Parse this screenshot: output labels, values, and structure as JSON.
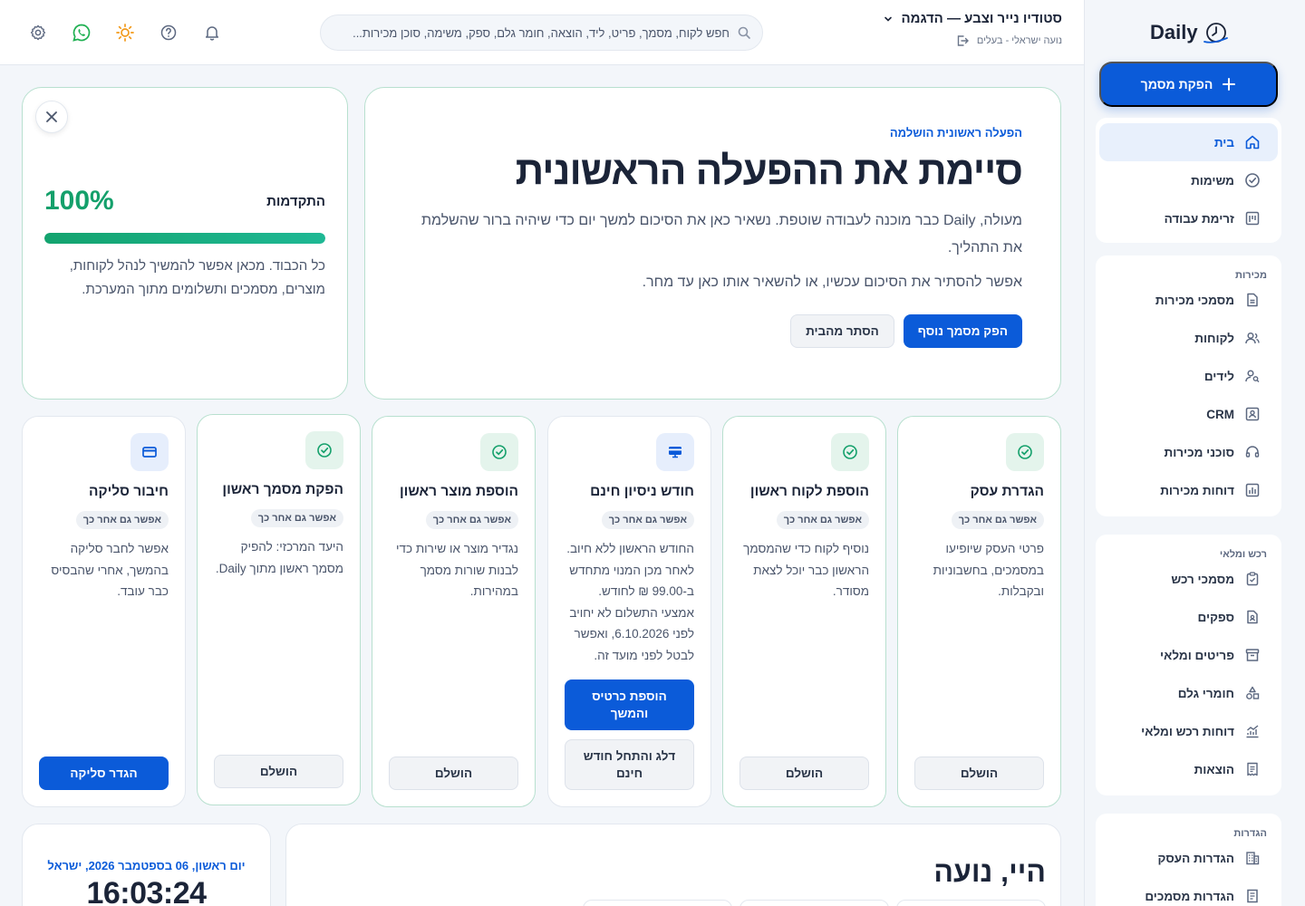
{
  "brand": {
    "logo_text": "Daily"
  },
  "sidebar": {
    "cta_label": "הפקת מסמך",
    "main": [
      {
        "label": "בית",
        "icon": "home-icon",
        "active": true
      },
      {
        "label": "משימות",
        "icon": "check-circle-icon"
      },
      {
        "label": "זרימת עבודה",
        "icon": "workflow-icon"
      }
    ],
    "sections": [
      {
        "title": "מכירות",
        "items": [
          {
            "label": "מסמכי מכירות",
            "icon": "document-icon"
          },
          {
            "label": "לקוחות",
            "icon": "users-icon"
          },
          {
            "label": "לידים",
            "icon": "user-search-icon"
          },
          {
            "label": "CRM",
            "icon": "contact-card-icon"
          },
          {
            "label": "סוכני מכירות",
            "icon": "headset-icon"
          },
          {
            "label": "דוחות מכירות",
            "icon": "bar-chart-icon"
          }
        ]
      },
      {
        "title": "רכש ומלאי",
        "items": [
          {
            "label": "מסמכי רכש",
            "icon": "clipboard-check-icon"
          },
          {
            "label": "ספקים",
            "icon": "supplier-file-icon"
          },
          {
            "label": "פריטים ומלאי",
            "icon": "archive-box-icon"
          },
          {
            "label": "חומרי גלם",
            "icon": "shapes-icon"
          },
          {
            "label": "דוחות רכש ומלאי",
            "icon": "line-chart-icon"
          },
          {
            "label": "הוצאות",
            "icon": "receipt-icon"
          }
        ]
      },
      {
        "title": "הגדרות",
        "items": [
          {
            "label": "הגדרות העסק",
            "icon": "building-icon"
          },
          {
            "label": "הגדרות מסמכים",
            "icon": "document-settings-icon"
          }
        ]
      }
    ]
  },
  "topbar": {
    "org_name": "סטודיו נייר וצבע — הדגמה",
    "user_line": "נועה ישראלי - בעלים",
    "search_placeholder": "חפש לקוח, מסמך, פריט, ליד, הוצאה, חומר גלם, ספק, משימה, סוכן מכירות..."
  },
  "hero": {
    "eyebrow": "הפעלה ראשונית הושלמה",
    "title": "סיימת את ההפעלה הראשונית",
    "paragraph": "מעולה, Daily כבר מוכנה לעבודה שוטפת. נשאיר כאן את הסיכום למשך יום כדי שיהיה ברור שהשלמת את התהליך.",
    "paragraph2": "אפשר להסתיר את הסיכום עכשיו, או להשאיר אותו כאן עד מחר.",
    "primary_button": "הפק מסמך נוסף",
    "ghost_button": "הסתר מהבית"
  },
  "progress": {
    "label": "התקדמות",
    "percent_text": "100%",
    "percent_value": 100,
    "text": "כל הכבוד. מכאן אפשר להמשיך לנהל לקוחות, מוצרים, מסמכים ותשלומים מתוך המערכת."
  },
  "steps": [
    {
      "title": "הגדרת עסק",
      "badge": "אפשר גם אחר כך",
      "desc": "פרטי העסק שיופיעו במסמכים, בחשבוניות ובקבלות.",
      "button": "הושלם",
      "status": "done",
      "icon": "check-circle-icon"
    },
    {
      "title": "הוספת לקוח ראשון",
      "badge": "אפשר גם אחר כך",
      "desc": "נוסיף לקוח כדי שהמסמך הראשון כבר יוכל לצאת מסודר.",
      "button": "הושלם",
      "status": "done",
      "icon": "check-circle-icon"
    },
    {
      "title": "חודש ניסיון חינם",
      "badge": "אפשר גם אחר כך",
      "desc": "החודש הראשון ללא חיוב. לאחר מכן המנוי מתחדש ב-99.00 ₪ לחודש. אמצעי התשלום לא יחויב לפני 6.10.2026, ואפשר לבטל לפני מועד זה.",
      "button": "הוספת כרטיס והמשך",
      "button2": "דלג והתחל חודש חינם",
      "status": "trial",
      "icon": "credit-card-icon"
    },
    {
      "title": "הוספת מוצר ראשון",
      "badge": "אפשר גם אחר כך",
      "desc": "נגדיר מוצר או שירות כדי לבנות שורות מסמך במהירות.",
      "button": "הושלם",
      "status": "done",
      "icon": "check-circle-icon"
    },
    {
      "title": "הפקת מסמך ראשון",
      "badge": "אפשר גם אחר כך",
      "desc": "היעד המרכזי: להפיק מסמך ראשון מתוך Daily.",
      "button": "הושלם",
      "status": "done",
      "icon": "check-circle-icon"
    },
    {
      "title": "חיבור סליקה",
      "badge": "אפשר גם אחר כך",
      "desc": "אפשר לחבר סליקה בהמשך, אחרי שהבסיס כבר עובד.",
      "button": "הגדר סליקה",
      "status": "pending",
      "icon": "card-icon"
    }
  ],
  "greeting": {
    "title": "היי, נועה"
  },
  "clock": {
    "date": "יום ראשון, 06 בספטמבר 2026, ישראל",
    "time": "16:03:24"
  },
  "colors": {
    "primary": "#0b5bd9",
    "success": "#14a06b",
    "border_done": "#b8e0cf"
  }
}
